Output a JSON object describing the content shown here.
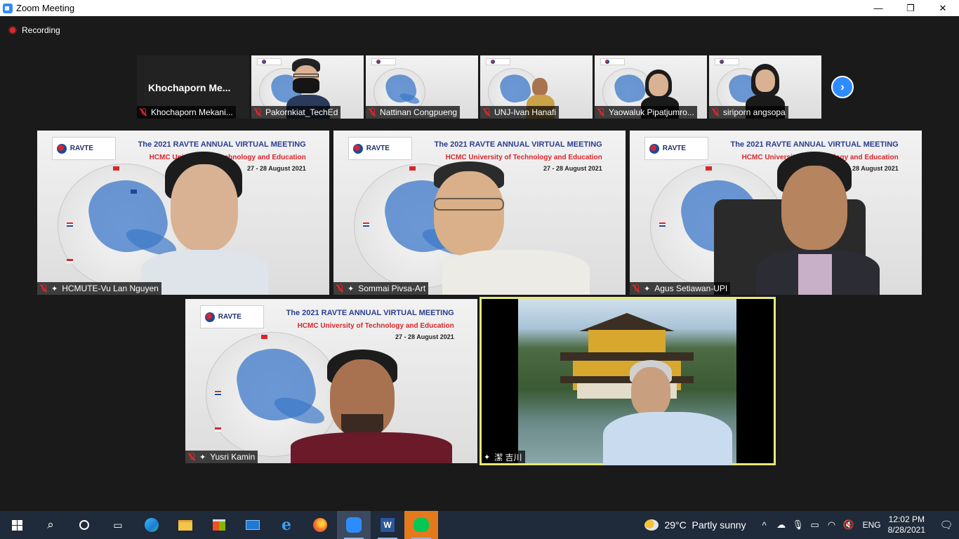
{
  "window": {
    "title": "Zoom Meeting",
    "minimize": "—",
    "maximize": "❐",
    "close": "✕"
  },
  "recording": {
    "label": "Recording"
  },
  "slide": {
    "logo_text": "RAVTE",
    "title": "The 2021 RAVTE ANNUAL VIRTUAL MEETING",
    "host": "HCMC University of Technology and Education",
    "dates": "27 - 28 August 2021"
  },
  "top_strip": {
    "name_only_tile": {
      "display_name": "Khochaporn  Me...",
      "label": "Khochaporn Mekani..."
    },
    "tiles": [
      {
        "label": "Pakornkiat_TechEd"
      },
      {
        "label": "Nattinan Congpueng"
      },
      {
        "label": "UNJ-Ivan Hanafi"
      },
      {
        "label": "Yaowaluk Pipatjumro..."
      },
      {
        "label": "siriporn angsopa"
      }
    ],
    "next_button": "›"
  },
  "gallery": [
    {
      "label": "HCMUTE-Vu Lan Nguyen"
    },
    {
      "label": "Sommai Pivsa-Art"
    },
    {
      "label": "Agus Setiawan-UPI"
    },
    {
      "label": "Yusri Kamin"
    },
    {
      "label": "潔 吉川"
    }
  ],
  "taskbar": {
    "weather": {
      "temp": "29°C",
      "text": "Partly sunny"
    },
    "lang": "ENG",
    "time": "12:02 PM",
    "date": "8/28/2021"
  },
  "colors": {
    "accent": "#2d8cff",
    "active_border": "#e6e87a",
    "muted": "#e02828"
  }
}
